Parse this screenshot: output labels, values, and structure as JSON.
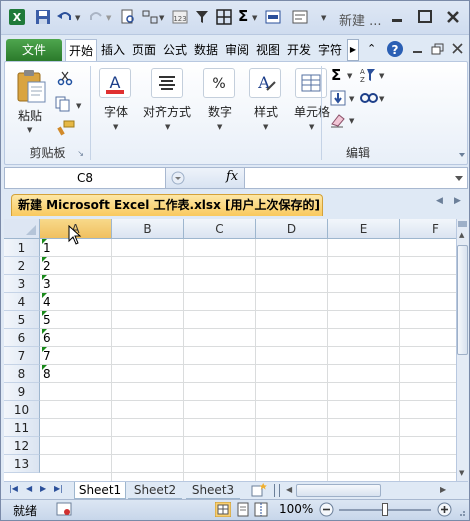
{
  "window": {
    "title": "新建 ..."
  },
  "tabs": [
    "文件",
    "开始",
    "插入",
    "页面",
    "公式",
    "数据",
    "审阅",
    "视图",
    "开发",
    "字符"
  ],
  "ribbon": {
    "paste_label": "粘贴",
    "clipboard_group": "剪贴板",
    "font_label": "字体",
    "align_label": "对齐方式",
    "number_label": "数字",
    "styles_label": "样式",
    "cells_label": "单元格",
    "edit_group": "编辑",
    "sigma": "Σ",
    "fx": "fx"
  },
  "formula_bar": {
    "name_box": "C8",
    "formula": ""
  },
  "workbook": {
    "title": "新建 Microsoft Excel 工作表.xlsx [用户上次保存的]"
  },
  "grid": {
    "columns": [
      "A",
      "B",
      "C",
      "D",
      "E",
      "F"
    ],
    "rows": [
      "1",
      "2",
      "3",
      "4",
      "5",
      "6",
      "7",
      "8",
      "9",
      "10",
      "11",
      "12",
      "13"
    ],
    "col_a_values": [
      "1",
      "2",
      "3",
      "4",
      "5",
      "6",
      "7",
      "8"
    ]
  },
  "sheets": [
    "Sheet1",
    "Sheet2",
    "Sheet3"
  ],
  "status": {
    "ready": "就绪",
    "zoom": "100%"
  },
  "colors": {
    "file_tab": "#2b7a2b",
    "workbook_tab": "#f9c95e",
    "selected_col": "#f0c060"
  }
}
